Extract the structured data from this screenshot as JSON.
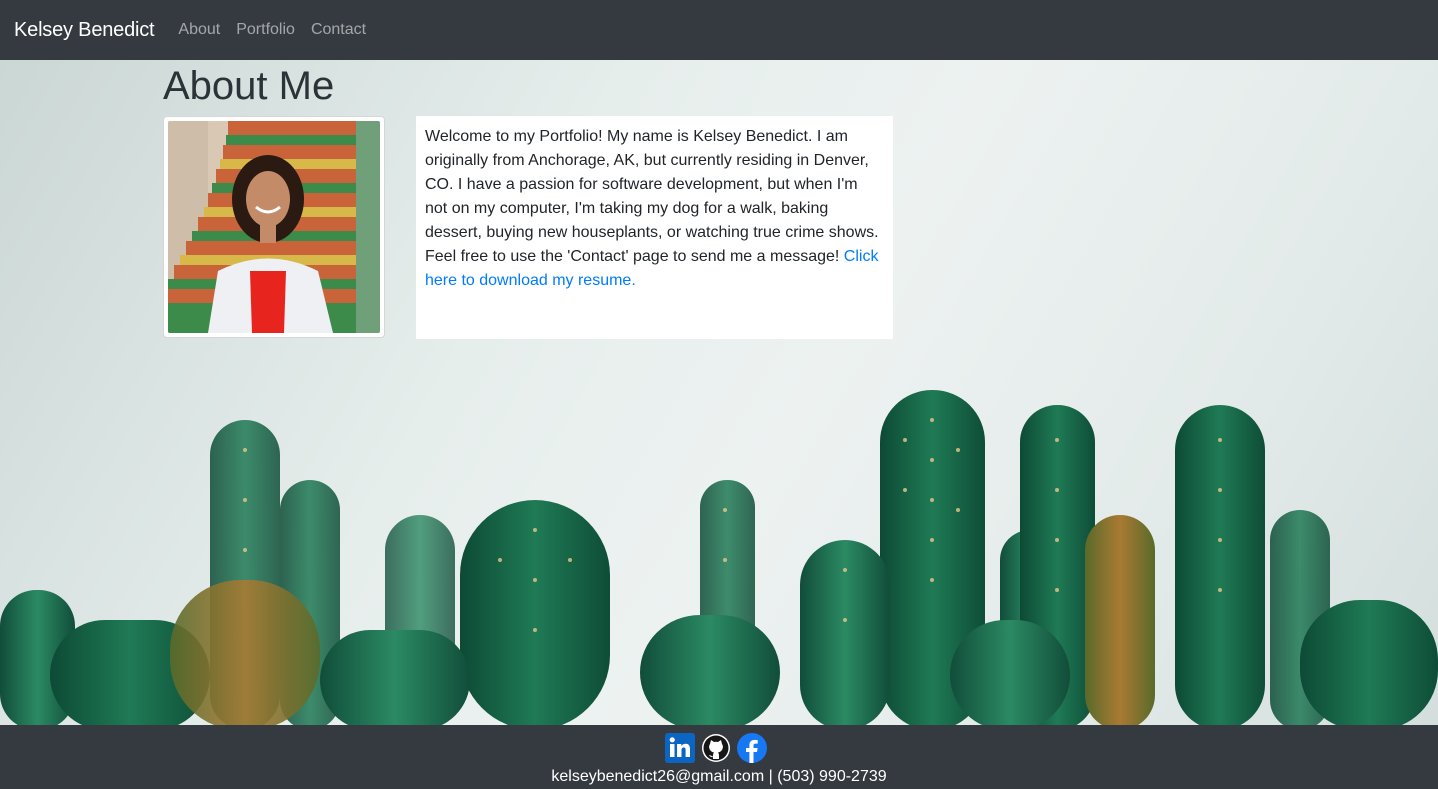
{
  "navbar": {
    "brand": "Kelsey Benedict",
    "links": [
      "About",
      "Portfolio",
      "Contact"
    ]
  },
  "about": {
    "heading": "About Me",
    "bio": "Welcome to my Portfolio! My name is Kelsey Benedict. I am originally from Anchorage, AK, but currently residing in Denver, CO. I have a passion for software development, but when I'm not on my computer, I'm taking my dog for a walk, baking dessert, buying new houseplants, or watching true crime shows. Feel free to use the 'Contact' page to send me a message!",
    "resume_link": "Click here to download my resume."
  },
  "footer": {
    "social_icons": [
      "linkedin-icon",
      "github-icon",
      "facebook-icon"
    ],
    "email": "kelseybenedict26@gmail.com",
    "separator": "|",
    "phone": "(503) 990-2739"
  },
  "colors": {
    "navbar_bg": "#343a40",
    "link": "#007bff",
    "linkedin": "#0a66c2",
    "facebook": "#1877f2"
  }
}
